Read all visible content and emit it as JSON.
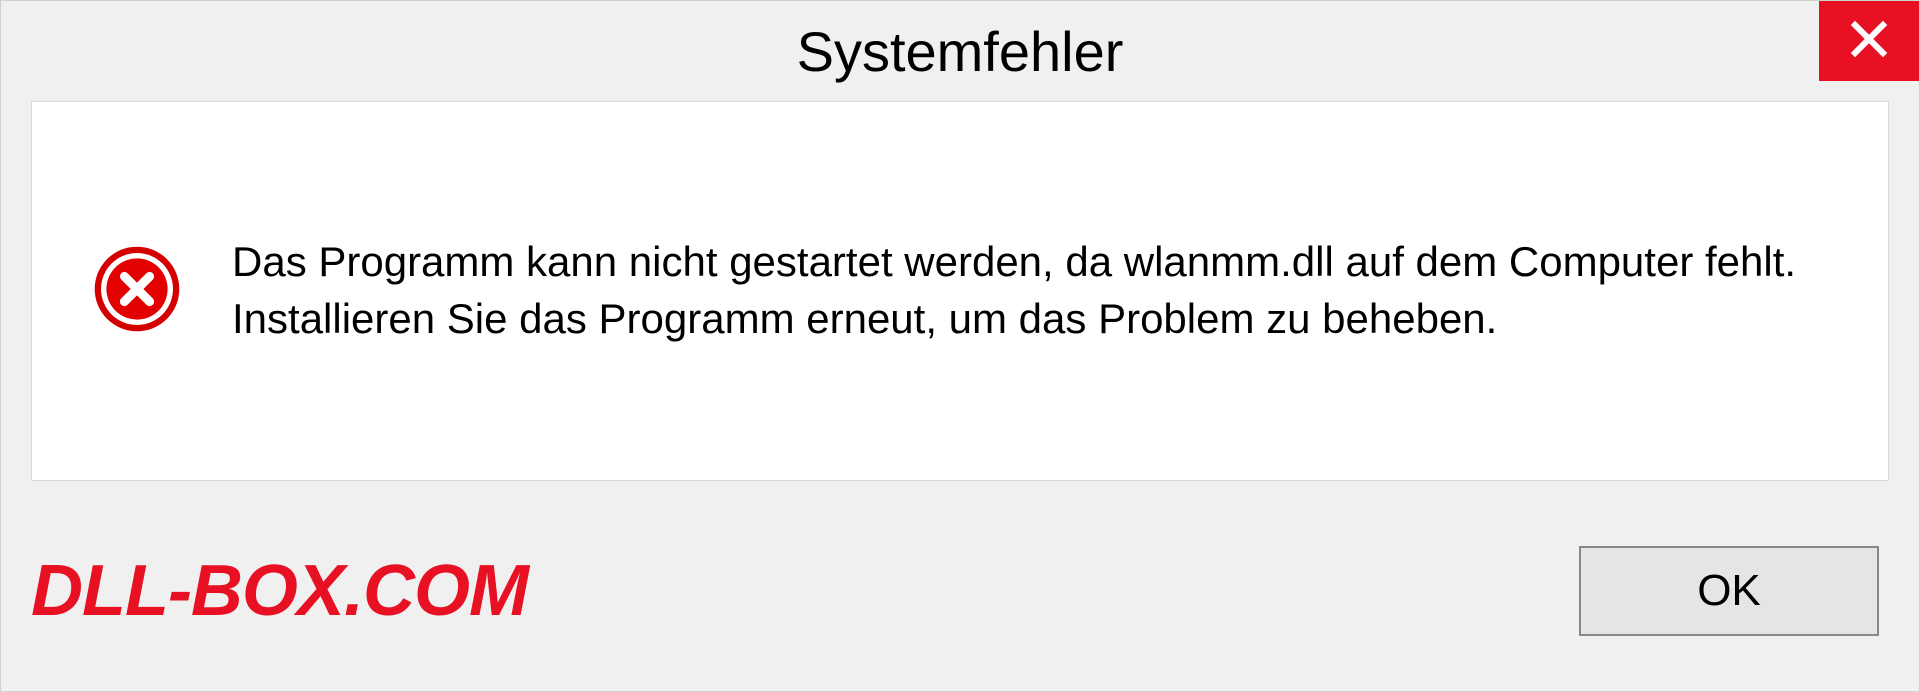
{
  "dialog": {
    "title": "Systemfehler",
    "message": "Das Programm kann nicht gestartet werden, da wlanmm.dll auf dem Computer fehlt. Installieren Sie das Programm erneut, um das Problem zu beheben.",
    "ok_label": "OK"
  },
  "watermark": "DLL-BOX.COM",
  "colors": {
    "close_bg": "#e81123",
    "error_icon": "#d40000"
  }
}
